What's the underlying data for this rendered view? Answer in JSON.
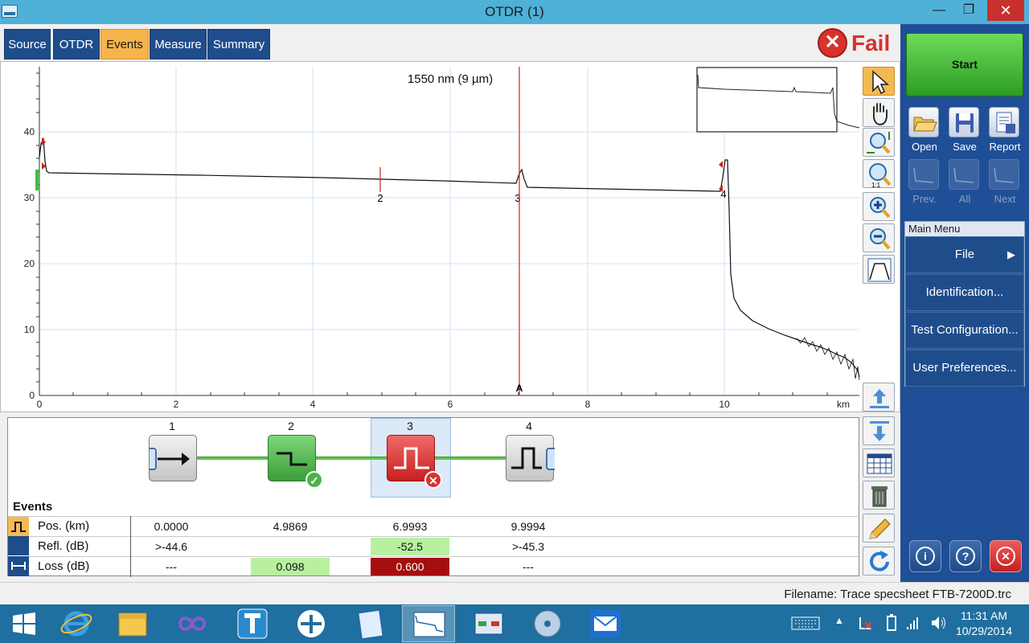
{
  "window": {
    "title": "OTDR (1)",
    "minimize_glyph": "—",
    "maximize_glyph": "❐",
    "close_glyph": "✕"
  },
  "tabs": [
    {
      "label": "Source",
      "active": false
    },
    {
      "label": "OTDR",
      "active": false
    },
    {
      "label": "Events",
      "active": true
    },
    {
      "label": "Measure",
      "active": false
    },
    {
      "label": "Summary",
      "active": false
    }
  ],
  "status": {
    "label": "Fail",
    "icon": "fail-x-icon",
    "color": "#d8322f"
  },
  "graph": {
    "wavelength_label": "1550 nm (9 µm)",
    "x_unit": "km",
    "x_ticks": [
      "0",
      "2",
      "4",
      "6",
      "8",
      "10"
    ],
    "y_ticks": [
      "0",
      "10",
      "20",
      "30",
      "40"
    ],
    "xlim": [
      0,
      12.5
    ],
    "ylim": [
      0,
      50
    ],
    "marker_label": "A",
    "marker_position_km": 7,
    "event_labels": [
      "2",
      "3",
      "4"
    ],
    "event_positions_km": [
      4.9869,
      6.9993,
      9.9994
    ]
  },
  "tools": [
    "pointer-icon",
    "pan-hand-icon",
    "zoom-fit-icon",
    "zoom-1to1-icon",
    "zoom-in-icon",
    "zoom-out-icon",
    "trace-view-icon",
    "move-up-icon",
    "move-down-icon",
    "table-view-icon",
    "delete-icon",
    "edit-icon",
    "refresh-icon"
  ],
  "events": {
    "heading": "Events",
    "numbers": [
      "1",
      "2",
      "3",
      "4"
    ],
    "icons": [
      "launch-level-icon",
      "non-reflective-icon",
      "reflective-fail-icon",
      "end-of-fiber-icon"
    ],
    "badges": [
      "",
      "✓",
      "✕",
      ""
    ],
    "rows": [
      {
        "label": "Pos. (km)",
        "icon": "event-icon",
        "values": [
          "0.0000",
          "4.9869",
          "6.9993",
          "9.9994"
        ]
      },
      {
        "label": "Refl. (dB)",
        "icon": "span-icon",
        "values": [
          ">-44.6",
          "",
          "-52.5",
          ">-45.3"
        ]
      },
      {
        "label": "Loss (dB)",
        "icon": "",
        "values": [
          "---",
          "0.098",
          "0.600",
          "---"
        ]
      }
    ]
  },
  "sidebar": {
    "start_label": "Start",
    "file_buttons": [
      {
        "label": "Open",
        "icon": "open-folder-icon"
      },
      {
        "label": "Save",
        "icon": "save-disk-icon"
      },
      {
        "label": "Report",
        "icon": "report-icon"
      }
    ],
    "trace_buttons": [
      {
        "label": "Prev.",
        "icon": "prev-trace-icon"
      },
      {
        "label": "All",
        "icon": "all-traces-icon"
      },
      {
        "label": "Next",
        "icon": "next-trace-icon"
      }
    ],
    "menu_header": "Main Menu",
    "menu_items": [
      "File",
      "Identification...",
      "Test Configuration...",
      "User Preferences..."
    ],
    "file_arrow": "▶",
    "bottom_buttons": [
      {
        "icon": "info-icon",
        "glyph": "i"
      },
      {
        "icon": "help-icon",
        "glyph": "?"
      },
      {
        "icon": "exit-icon",
        "glyph": "✕"
      }
    ]
  },
  "statusbar": {
    "filename": "Filename: Trace specsheet FTB-7200D.trc"
  },
  "taskbar": {
    "apps": [
      "windows-start-icon",
      "internet-explorer-icon",
      "file-explorer-icon",
      "app-infinity-icon",
      "app-t-icon",
      "app-teamviewer-icon",
      "notepad-icon",
      "otdr-app-icon",
      "network-app-icon",
      "disc-app-icon",
      "mail-icon"
    ],
    "time": "11:31 AM",
    "date": "10/29/2014"
  }
}
